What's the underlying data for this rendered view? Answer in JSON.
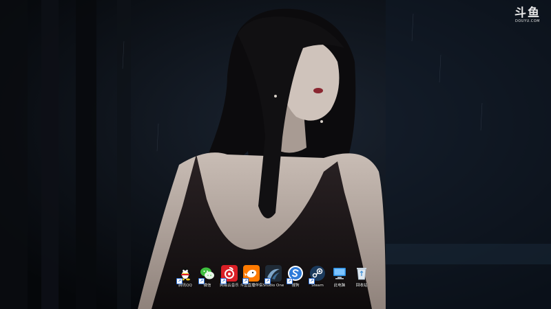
{
  "watermark": {
    "logo": "斗鱼",
    "sub": "DOUYU.COM"
  },
  "desktop": {
    "icons": [
      {
        "label": "腾讯QQ",
        "icon": "qq-penguin-icon",
        "shortcut": true
      },
      {
        "label": "微信",
        "icon": "wechat-icon",
        "shortcut": true
      },
      {
        "label": "网易云音乐",
        "icon": "netease-music-icon",
        "shortcut": true
      },
      {
        "label": "斗鱼直播伴侣",
        "icon": "douyu-companion-icon",
        "shortcut": true
      },
      {
        "label": "Studio One",
        "icon": "studio-one-icon",
        "shortcut": true
      },
      {
        "label": "搜狗",
        "icon": "sogou-icon",
        "shortcut": true
      },
      {
        "label": "Steam",
        "icon": "steam-icon",
        "shortcut": true
      },
      {
        "label": "此电脑",
        "icon": "this-pc-icon",
        "shortcut": false
      },
      {
        "label": "回收站",
        "icon": "recycle-bin-icon",
        "shortcut": false
      }
    ]
  },
  "colors": {
    "background": "#07090d",
    "qq": "#f5c518",
    "wechat": "#3fbf3f",
    "netease": "#d91f26",
    "douyu": "#ff7a00",
    "sogou": "#ffffff",
    "steam": "#1b3a5c"
  }
}
